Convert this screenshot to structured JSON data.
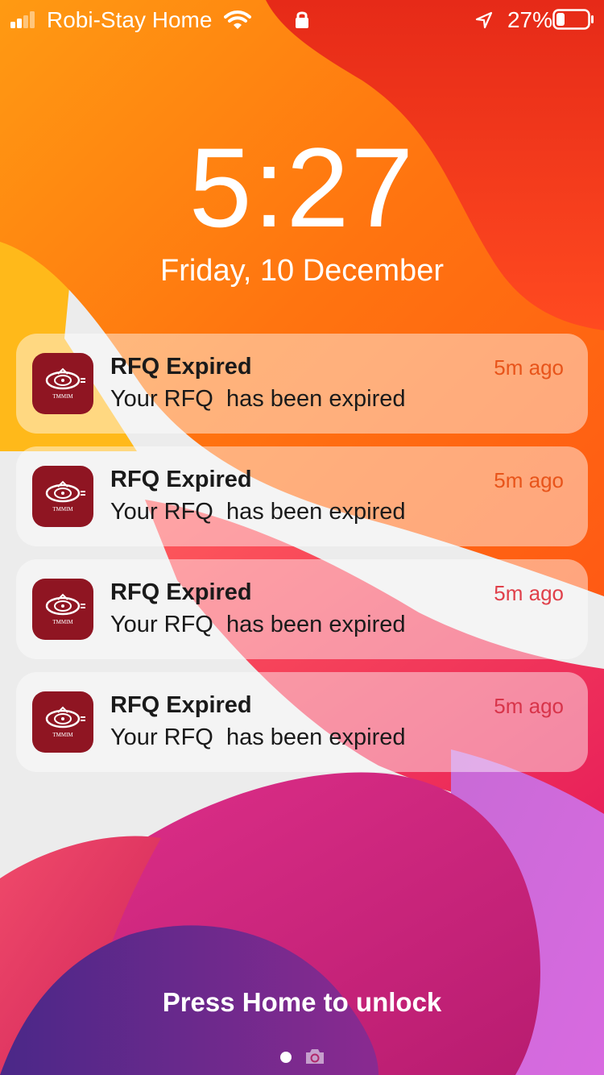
{
  "status_bar": {
    "carrier": "Robi-Stay Home",
    "battery_percent_label": "27%",
    "battery_level": 0.27,
    "icons": [
      "signal-icon",
      "wifi-icon",
      "lock-icon",
      "location-icon",
      "battery-icon"
    ]
  },
  "lock_screen": {
    "time": "5:27",
    "date": "Friday, 10 December"
  },
  "notifications": [
    {
      "title": "RFQ Expired",
      "body": "Your RFQ  has been expired",
      "time": "5m ago",
      "app_icon_text": "TMMIM"
    },
    {
      "title": "RFQ Expired",
      "body": "Your RFQ  has been expired",
      "time": "5m ago",
      "app_icon_text": "TMMIM"
    },
    {
      "title": "RFQ Expired",
      "body": "Your RFQ  has been expired",
      "time": "5m ago",
      "app_icon_text": "TMMIM"
    },
    {
      "title": "RFQ Expired",
      "body": "Your RFQ  has been expired",
      "time": "5m ago",
      "app_icon_text": "TMMIM"
    }
  ],
  "bottom": {
    "unlock_hint": "Press Home to unlock",
    "icons": [
      "page-dot",
      "camera-icon"
    ]
  },
  "colors": {
    "app_icon_bg": "#8f1522",
    "notification_time_orange": "#e8541a",
    "notification_time_red": "#d8344a",
    "wallpaper_orange": "#ff7a10",
    "wallpaper_red": "#f0302a",
    "wallpaper_magenta": "#d02a80",
    "wallpaper_purple": "#5a2a8c"
  }
}
